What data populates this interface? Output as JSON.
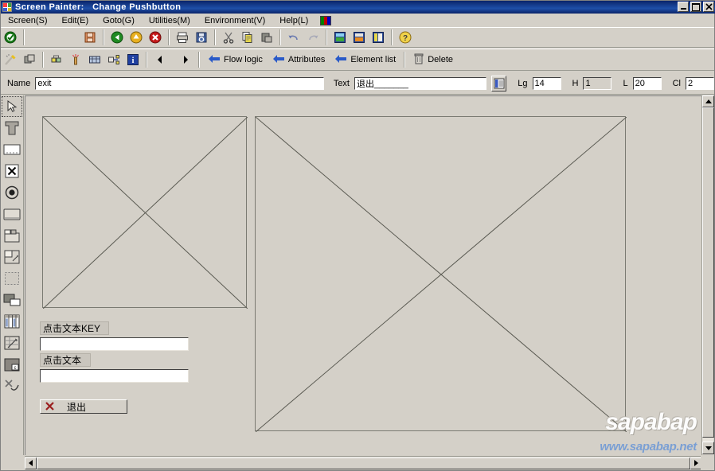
{
  "window": {
    "title": "Screen Painter:   Change Pushbutton",
    "icon": "sap-logo-icon",
    "controls": {
      "minimize": "_",
      "maximize": "□",
      "close": "✕"
    }
  },
  "menubar": {
    "items": [
      {
        "label": "Screen(S)",
        "name": "menu-screen"
      },
      {
        "label": "Edit(E)",
        "name": "menu-edit"
      },
      {
        "label": "Goto(G)",
        "name": "menu-goto"
      },
      {
        "label": "Utilities(M)",
        "name": "menu-utilities"
      },
      {
        "label": "Environment(V)",
        "name": "menu-environment"
      },
      {
        "label": "Help(L)",
        "name": "menu-help"
      }
    ],
    "colorbox": "layout-color-icon"
  },
  "toolbar1": {
    "buttons": [
      {
        "name": "confirm-check-icon",
        "tooltip": "Continue"
      },
      {
        "name": "save-icon",
        "tooltip": "Save"
      },
      {
        "name": "back-green-icon",
        "tooltip": "Back"
      },
      {
        "name": "exit-yellow-icon",
        "tooltip": "Exit"
      },
      {
        "name": "cancel-red-icon",
        "tooltip": "Cancel"
      },
      {
        "name": "print-icon",
        "tooltip": "Print"
      },
      {
        "name": "find-icon",
        "tooltip": "Find"
      },
      {
        "name": "cut-scissors-icon",
        "tooltip": "Cut"
      },
      {
        "name": "copy-icon",
        "tooltip": "Copy"
      },
      {
        "name": "paste-icon",
        "tooltip": "Paste"
      },
      {
        "name": "undo-icon",
        "tooltip": "Undo"
      },
      {
        "name": "redo-icon",
        "tooltip": "Redo"
      },
      {
        "name": "layout-green-icon",
        "tooltip": "Layout"
      },
      {
        "name": "layout-orange-icon",
        "tooltip": "Layout"
      },
      {
        "name": "layout-blue-icon",
        "tooltip": "Layout"
      },
      {
        "name": "help-question-icon",
        "tooltip": "Help"
      }
    ]
  },
  "toolbar2": {
    "icon_buttons": [
      {
        "name": "magic-wand-icon"
      },
      {
        "name": "graphical-layout-icon"
      },
      {
        "name": "group-elements-icon"
      },
      {
        "name": "highlight-icon"
      },
      {
        "name": "screen-attributes-icon"
      },
      {
        "name": "element-link-icon"
      },
      {
        "name": "information-icon"
      },
      {
        "name": "previous-arrow-icon"
      },
      {
        "name": "next-arrow-icon"
      }
    ],
    "text_buttons": [
      {
        "label": "Flow logic",
        "name": "flow-logic-button",
        "icon": "left-arrow-icon"
      },
      {
        "label": "Attributes",
        "name": "attributes-button",
        "icon": "left-arrow-icon"
      },
      {
        "label": "Element list",
        "name": "element-list-button",
        "icon": "left-arrow-icon"
      }
    ],
    "delete": {
      "label": "Delete",
      "name": "delete-button",
      "icon": "trash-icon"
    }
  },
  "fieldbar": {
    "name_label": "Name",
    "name_value": "exit",
    "text_label": "Text",
    "text_value": "退出_______",
    "picker_icon": "list-picker-icon",
    "lg_label": "Lg",
    "lg_value": "14",
    "h_label": "H",
    "h_value": "1",
    "l_label": "L",
    "l_value": "20",
    "cl_label": "Cl",
    "cl_value": "2"
  },
  "palette": {
    "items": [
      {
        "name": "pointer-tool-icon",
        "selected": true
      },
      {
        "name": "text-field-tool-icon",
        "selected": false
      },
      {
        "name": "input-output-field-tool-icon",
        "selected": false
      },
      {
        "name": "checkbox-tool-icon",
        "selected": false
      },
      {
        "name": "radio-button-tool-icon",
        "selected": false
      },
      {
        "name": "pushbutton-tool-icon",
        "selected": false
      },
      {
        "name": "tabstrip-tool-icon",
        "selected": false
      },
      {
        "name": "subscreen-tool-icon",
        "selected": false
      },
      {
        "name": "box-tool-icon",
        "selected": false
      },
      {
        "name": "step-loop-tool-icon",
        "selected": false
      },
      {
        "name": "table-control-tool-icon",
        "selected": false
      },
      {
        "name": "custom-control-tool-icon",
        "selected": false
      },
      {
        "name": "status-icon-tool-icon",
        "selected": false
      },
      {
        "name": "misc-tool-icon",
        "selected": false
      }
    ]
  },
  "canvas": {
    "placeholders": [
      {
        "name": "subscreen-placeholder-left"
      },
      {
        "name": "subscreen-placeholder-right"
      }
    ],
    "elements": [
      {
        "type": "label",
        "name": "screen-label-key",
        "text": "点击文本KEY"
      },
      {
        "type": "input",
        "name": "screen-input-key",
        "value": ""
      },
      {
        "type": "label",
        "name": "screen-label-text",
        "text": "点击文本"
      },
      {
        "type": "input",
        "name": "screen-input-text",
        "value": ""
      },
      {
        "type": "button",
        "name": "screen-exit-button",
        "text": "退出",
        "icon": "red-x-icon"
      }
    ]
  },
  "watermark": {
    "line1": "sapabap",
    "line2": "www.sapabap.net"
  },
  "colors": {
    "window_bg": "#d4d0c8",
    "titlebar": "#0a246a",
    "field_white": "#ffffff",
    "border_dark": "#808080",
    "accent_blue": "#1f4fa8",
    "watermark_blue": "#7a9fd4",
    "exit_red": "#9b2020"
  }
}
